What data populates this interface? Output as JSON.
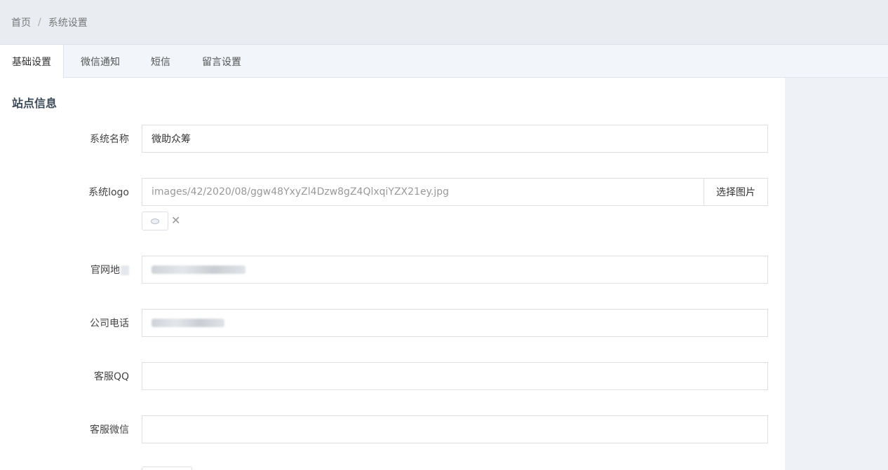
{
  "breadcrumb": {
    "home": "首页",
    "separator": "/",
    "current": "系统设置"
  },
  "tabs": [
    {
      "label": "基础设置",
      "active": true
    },
    {
      "label": "微信通知",
      "active": false
    },
    {
      "label": "短信",
      "active": false
    },
    {
      "label": "留言设置",
      "active": false
    }
  ],
  "section": {
    "title": "站点信息"
  },
  "form": {
    "system_name": {
      "label": "系统名称",
      "value": "微助众筹"
    },
    "system_logo": {
      "label": "系统logo",
      "value": "images/42/2020/08/ggw48YxyZl4Dzw8gZ4QlxqiYZX21ey.jpg",
      "button": "选择图片",
      "remove_icon": "close-icon"
    },
    "website": {
      "label": "官网地"
    },
    "company_phone": {
      "label": "公司电话"
    },
    "service_qq": {
      "label": "客服QQ",
      "value": ""
    },
    "service_wechat": {
      "label": "客服微信",
      "value": ""
    }
  },
  "colors": {
    "topbar": "#e9edf2",
    "tabs": "#f2f6fa",
    "border": "#dcdfe6",
    "section_title": "#3d4a57"
  }
}
